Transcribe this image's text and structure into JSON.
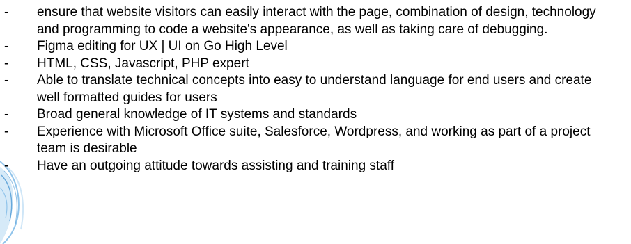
{
  "bullet_marker": "-",
  "bullets": [
    "ensure that website visitors can easily interact with the page, combination of design, technology and programming to code a website's appearance, as well as taking care of debugging.",
    "Figma editing for UX | UI on Go High Level",
    "HTML, CSS, Javascript, PHP expert",
    "Able to translate technical concepts into easy to understand language for end users and create well formatted guides for users",
    "Broad general knowledge of IT systems and standards",
    "Experience with Microsoft Office suite, Salesforce, Wordpress, and working as part of a project team is desirable",
    "Have an outgoing attitude towards assisting and training staff"
  ],
  "colors": {
    "text": "#000000",
    "background": "#ffffff",
    "decor_light": "#cfe6f7",
    "decor_mid": "#8fc3ea",
    "decor_dark": "#4b97d3"
  }
}
